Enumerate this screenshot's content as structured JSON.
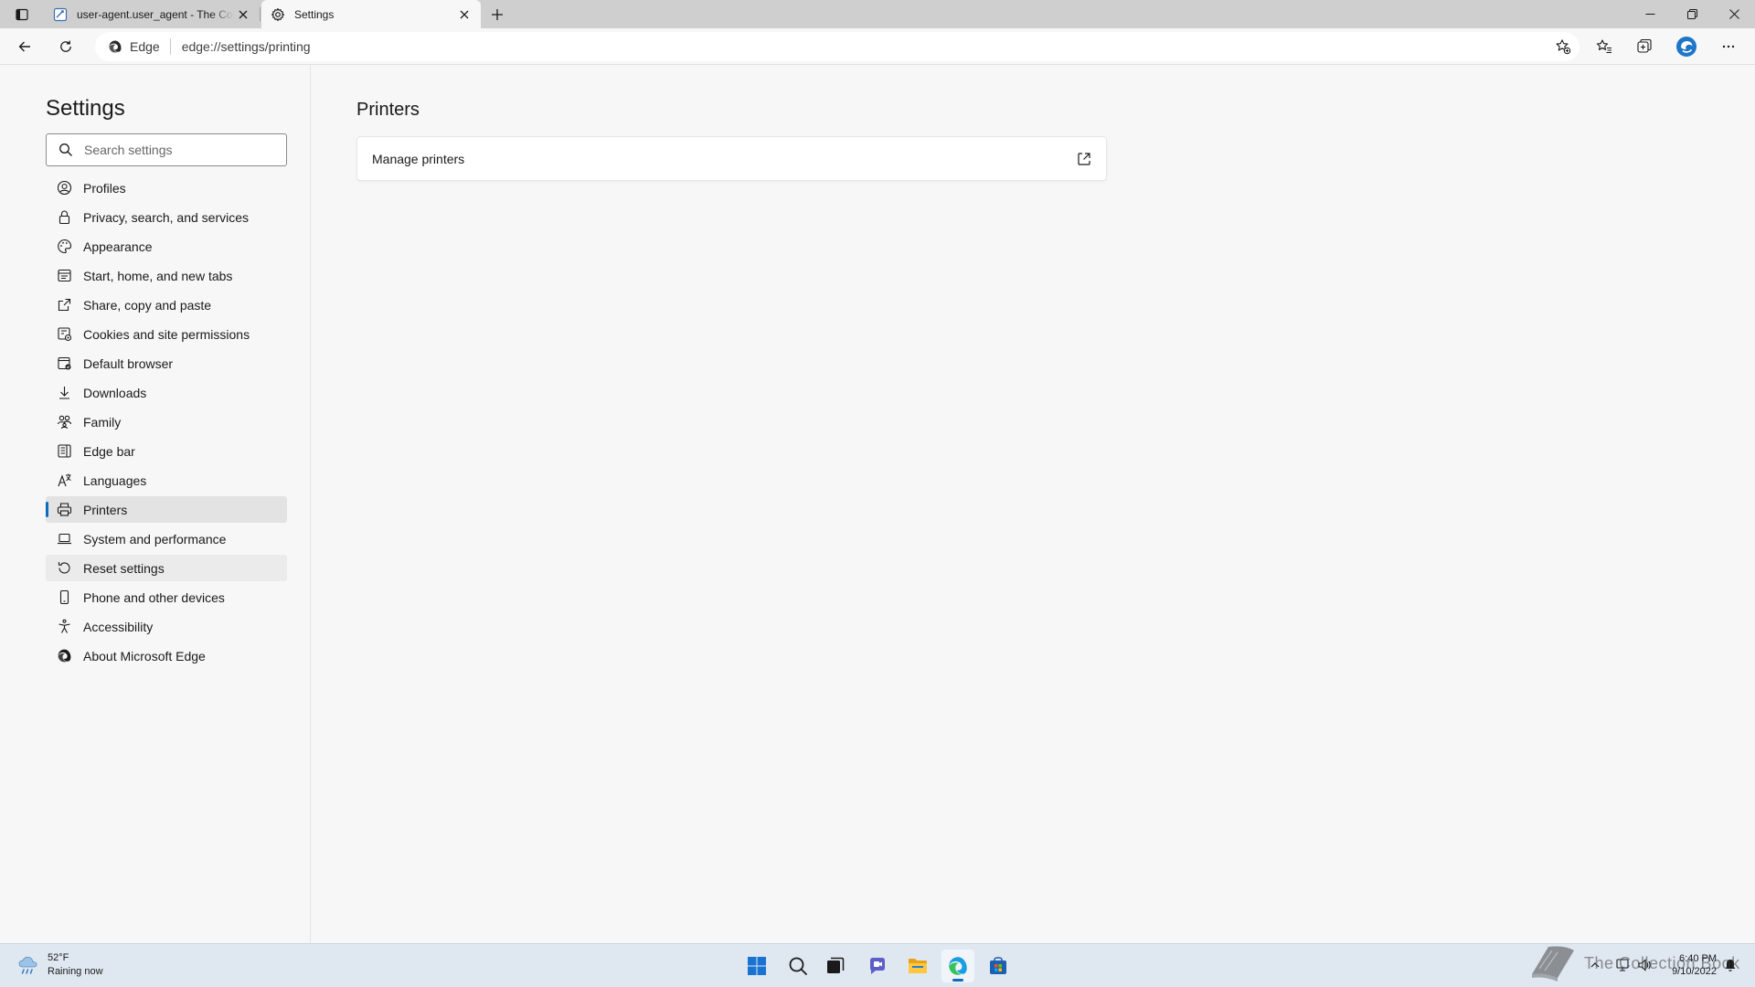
{
  "browser": {
    "tabs": [
      {
        "title": "user-agent.user_agent - The Coll",
        "active": false
      },
      {
        "title": "Settings",
        "active": true
      }
    ],
    "address": {
      "site_label": "Edge",
      "url_scheme": "edge://",
      "url_path": "settings/printing"
    }
  },
  "settings": {
    "title": "Settings",
    "search_placeholder": "Search settings",
    "nav": [
      {
        "label": "Profiles",
        "icon": "profile-icon"
      },
      {
        "label": "Privacy, search, and services",
        "icon": "lock-icon"
      },
      {
        "label": "Appearance",
        "icon": "palette-icon"
      },
      {
        "label": "Start, home, and new tabs",
        "icon": "home-tabs-icon"
      },
      {
        "label": "Share, copy and paste",
        "icon": "share-icon"
      },
      {
        "label": "Cookies and site permissions",
        "icon": "cookies-icon"
      },
      {
        "label": "Default browser",
        "icon": "default-browser-icon"
      },
      {
        "label": "Downloads",
        "icon": "download-icon"
      },
      {
        "label": "Family",
        "icon": "family-icon"
      },
      {
        "label": "Edge bar",
        "icon": "edge-bar-icon"
      },
      {
        "label": "Languages",
        "icon": "languages-icon"
      },
      {
        "label": "Printers",
        "icon": "printer-icon",
        "active": true
      },
      {
        "label": "System and performance",
        "icon": "laptop-icon"
      },
      {
        "label": "Reset settings",
        "icon": "reset-icon",
        "hover": true
      },
      {
        "label": "Phone and other devices",
        "icon": "phone-icon"
      },
      {
        "label": "Accessibility",
        "icon": "accessibility-icon"
      },
      {
        "label": "About Microsoft Edge",
        "icon": "edge-logo-icon"
      }
    ]
  },
  "content": {
    "page_title": "Printers",
    "rows": [
      {
        "label": "Manage printers",
        "icon": "external-link-icon"
      }
    ]
  },
  "taskbar": {
    "weather": {
      "temp": "52°F",
      "condition": "Raining now"
    },
    "watermark": "The Collection Book",
    "clock": {
      "time": "6:40 PM",
      "date": "9/10/2022"
    }
  },
  "colors": {
    "accent": "#0f6cbd",
    "tabstrip": "#cfcfcf",
    "page_bg": "#f7f7f7",
    "taskbar": "#dfe8f1"
  }
}
